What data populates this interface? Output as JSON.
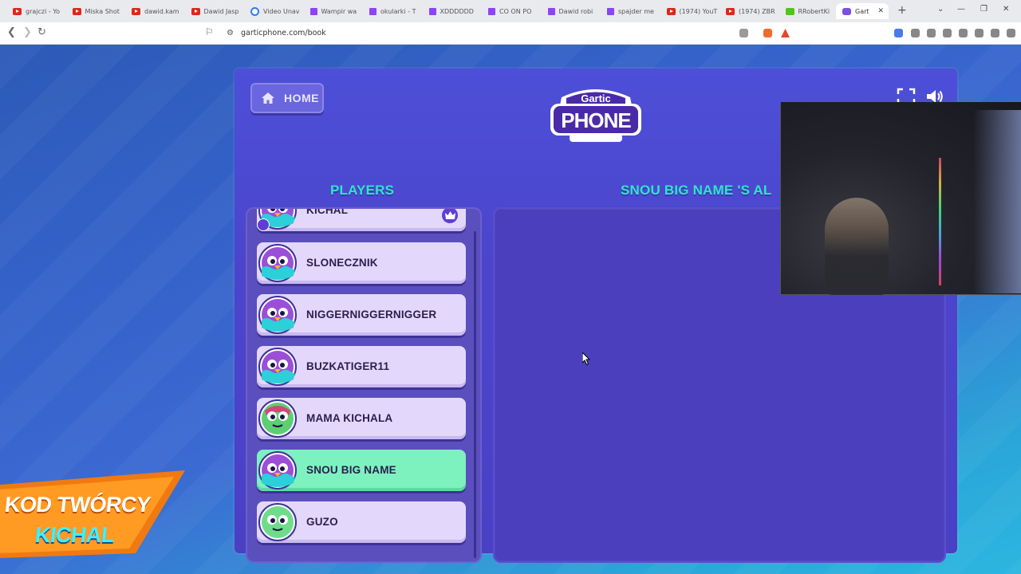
{
  "browser": {
    "tabs": [
      {
        "label": "grajczi - Yo",
        "icon": "youtube-icon",
        "kind": "yt"
      },
      {
        "label": "Miska Shot",
        "icon": "youtube-icon",
        "kind": "yt"
      },
      {
        "label": "dawid.kam",
        "icon": "youtube-icon",
        "kind": "yt"
      },
      {
        "label": "Dawid Jasp",
        "icon": "youtube-icon",
        "kind": "yt"
      },
      {
        "label": "Video Unav",
        "icon": "globe-icon",
        "kind": "gl"
      },
      {
        "label": "Wampir wa",
        "icon": "twitch-icon",
        "kind": "tw"
      },
      {
        "label": "okularki - T",
        "icon": "twitch-icon",
        "kind": "tw"
      },
      {
        "label": "XDDDDDD",
        "icon": "twitch-icon",
        "kind": "tw"
      },
      {
        "label": "CO ON PO",
        "icon": "twitch-icon",
        "kind": "tw"
      },
      {
        "label": "Dawid robi",
        "icon": "twitch-icon",
        "kind": "tw"
      },
      {
        "label": "spajder me",
        "icon": "twitch-icon",
        "kind": "tw"
      },
      {
        "label": "(1974) YouT",
        "icon": "youtube-icon",
        "kind": "yt"
      },
      {
        "label": "(1974) ZBR",
        "icon": "youtube-icon",
        "kind": "yt"
      },
      {
        "label": "RRobertKi",
        "icon": "kick-icon",
        "kind": "kk"
      }
    ],
    "active_tab": {
      "label": "Gart",
      "icon": "gartic-icon"
    },
    "new_tab": "+",
    "url": "garticphone.com/book"
  },
  "game": {
    "home_label": "HOME",
    "logo_top": "Gartic",
    "logo_bottom": "PHONE",
    "players_title": "PLAYERS",
    "album_title": "SNOU BIG NAME 'S AL",
    "players": [
      {
        "name": "KICHAL",
        "host": true,
        "me": false
      },
      {
        "name": "SLONECZNIK",
        "host": false,
        "me": false
      },
      {
        "name": "NIGGERNIGGERNIGGER",
        "host": false,
        "me": false
      },
      {
        "name": "BUZKATIGER11",
        "host": false,
        "me": false
      },
      {
        "name": "MAMA KICHALA",
        "host": false,
        "me": false
      },
      {
        "name": "SNOU BIG NAME",
        "host": false,
        "me": true
      },
      {
        "name": "GUZO",
        "host": false,
        "me": false
      }
    ]
  },
  "overlay": {
    "creator_line1": "KOD TWÓRCY",
    "creator_line2": "KICHAL"
  },
  "colors": {
    "accent_title": "#2ee6c8",
    "player_card": "#e3d8fb",
    "player_me": "#7df2bf",
    "panel": "#4b3fbe"
  }
}
